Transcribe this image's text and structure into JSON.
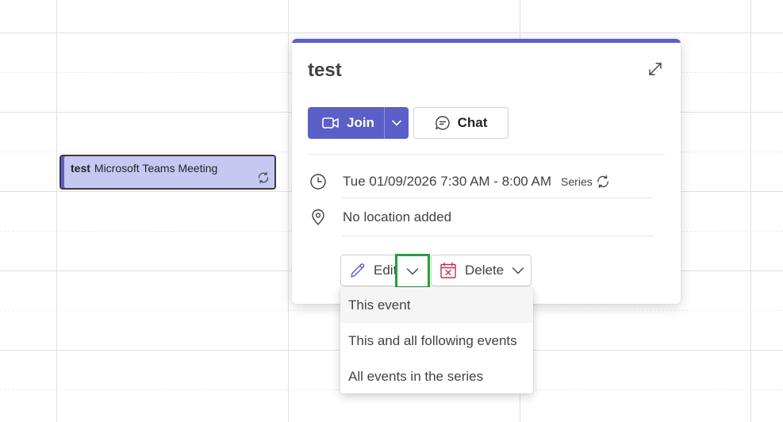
{
  "calendar_event": {
    "title": "test",
    "subtitle": "Microsoft Teams Meeting",
    "recurring_icon": "recurring-icon",
    "color": "#c5c8f0"
  },
  "popup": {
    "title": "test",
    "expand_icon": "expand-icon",
    "accent_color": "#5b5fc7",
    "join": {
      "label": "Join",
      "icon": "video-camera-icon",
      "dropdown_icon": "chevron-down-icon"
    },
    "chat": {
      "label": "Chat",
      "icon": "chat-bubble-icon"
    },
    "time": {
      "icon": "clock-icon",
      "text": "Tue 01/09/2026 7:30 AM - 8:00 AM",
      "series_label": "Series",
      "series_icon": "recurring-icon"
    },
    "location": {
      "icon": "location-pin-icon",
      "text": "No location added"
    },
    "edit": {
      "label": "Edit",
      "icon": "pencil-icon",
      "dropdown_icon": "chevron-down-icon",
      "highlight_color": "#1fa33a"
    },
    "delete": {
      "label": "Delete",
      "icon": "calendar-delete-icon",
      "dropdown_icon": "chevron-down-icon",
      "icon_color": "#c4314b"
    }
  },
  "edit_menu": {
    "items": [
      {
        "label": "This event",
        "highlighted": true
      },
      {
        "label": "This and all following events",
        "highlighted": false
      },
      {
        "label": "All events in the series",
        "highlighted": false
      }
    ]
  }
}
